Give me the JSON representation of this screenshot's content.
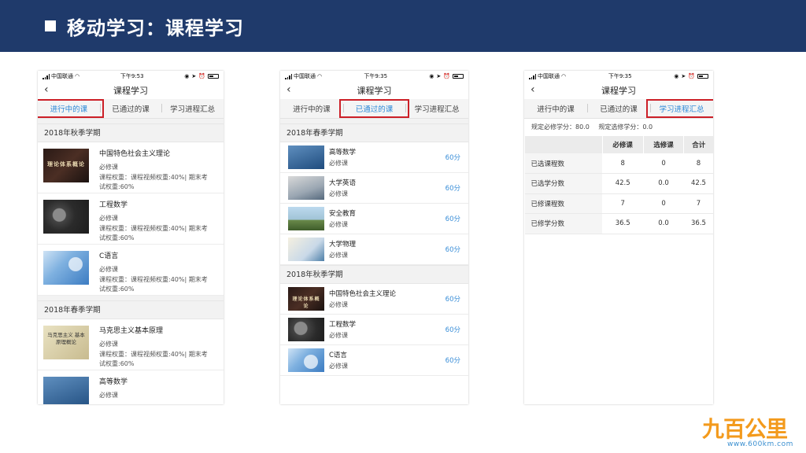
{
  "slide": {
    "title": "移动学习：课程学习"
  },
  "phones": [
    {
      "status": {
        "carrier": "中国联通",
        "time": "下午9:53"
      },
      "nav_title": "课程学习",
      "tabs": [
        "进行中的课",
        "已通过的课",
        "学习进程汇总"
      ],
      "active_tab": 0,
      "sections": [
        {
          "label": "2018年秋季学期",
          "courses": [
            {
              "name": "中国特色社会主义理论",
              "type": "必修课",
              "weight1": "课程权重：课程视频权重:40%| 期末考",
              "weight2": "试权重:60%",
              "thumb_text": "理论体系概论"
            },
            {
              "name": "工程数学",
              "type": "必修课",
              "weight1": "课程权重：课程视频权重:40%| 期末考",
              "weight2": "试权重:60%"
            },
            {
              "name": "C语言",
              "type": "必修课",
              "weight1": "课程权重：课程视频权重:40%| 期末考",
              "weight2": "试权重:60%"
            }
          ]
        },
        {
          "label": "2018年春季学期",
          "courses": [
            {
              "name": "马克思主义基本原理",
              "type": "必修课",
              "weight1": "课程权重：课程视频权重:40%| 期末考",
              "weight2": "试权重:60%",
              "thumb_text": "马克思主义 基本原理概论"
            },
            {
              "name": "高等数学",
              "type": "必修课"
            }
          ]
        }
      ]
    },
    {
      "status": {
        "carrier": "中国联通",
        "time": "下午9:35"
      },
      "nav_title": "课程学习",
      "tabs": [
        "进行中的课",
        "已通过的课",
        "学习进程汇总"
      ],
      "active_tab": 1,
      "sections": [
        {
          "label": "2018年春季学期",
          "courses": [
            {
              "name": "高等数学",
              "type": "必修课",
              "score": "60分"
            },
            {
              "name": "大学英语",
              "type": "必修课",
              "score": "60分"
            },
            {
              "name": "安全教育",
              "type": "必修课",
              "score": "60分"
            },
            {
              "name": "大学物理",
              "type": "必修课",
              "score": "60分"
            }
          ]
        },
        {
          "label": "2018年秋季学期",
          "courses": [
            {
              "name": "中国特色社会主义理论",
              "type": "必修课",
              "score": "60分",
              "thumb_text": "理论体系概论"
            },
            {
              "name": "工程数学",
              "type": "必修课",
              "score": "60分"
            },
            {
              "name": "C语言",
              "type": "必修课",
              "score": "60分"
            }
          ]
        }
      ]
    },
    {
      "status": {
        "carrier": "中国联通",
        "time": "下午9:35"
      },
      "nav_title": "课程学习",
      "tabs": [
        "进行中的课",
        "已通过的课",
        "学习进程汇总"
      ],
      "active_tab": 2,
      "summary": {
        "required_credits": "规定必修学分：80.0",
        "elective_credits": "规定选修学分：0.0"
      },
      "table": {
        "headers": [
          "",
          "必修课",
          "选修课",
          "合计"
        ],
        "rows": [
          [
            "已选课程数",
            "8",
            "0",
            "8"
          ],
          [
            "已选学分数",
            "42.5",
            "0.0",
            "42.5"
          ],
          [
            "已修课程数",
            "7",
            "0",
            "7"
          ],
          [
            "已修学分数",
            "36.5",
            "0.0",
            "36.5"
          ]
        ]
      }
    }
  ],
  "logo": {
    "text": "九百公里",
    "url": "www.600km.com"
  },
  "colors": {
    "header_bg": "#1f3a6b",
    "active_tab": "#2f8ad8",
    "highlight_box": "#cc1f27",
    "score": "#3b8fd8",
    "logo": "#f39a1c"
  }
}
